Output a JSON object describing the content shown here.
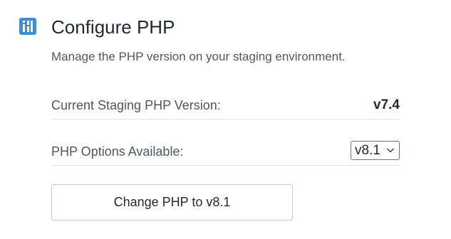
{
  "header": {
    "icon": "php-config-icon",
    "title": "Configure PHP"
  },
  "description": "Manage the PHP version on your staging environment.",
  "current_version": {
    "label": "Current Staging PHP Version:",
    "value": "v7.4"
  },
  "php_options": {
    "label": "PHP Options Available:",
    "selected": "v8.1"
  },
  "change_button": {
    "label": "Change PHP to v8.1"
  },
  "colors": {
    "icon_accent": "#3b8fd9",
    "text_primary": "#1f2833",
    "text_secondary": "#4e5864",
    "divider": "#dfe3e8"
  }
}
